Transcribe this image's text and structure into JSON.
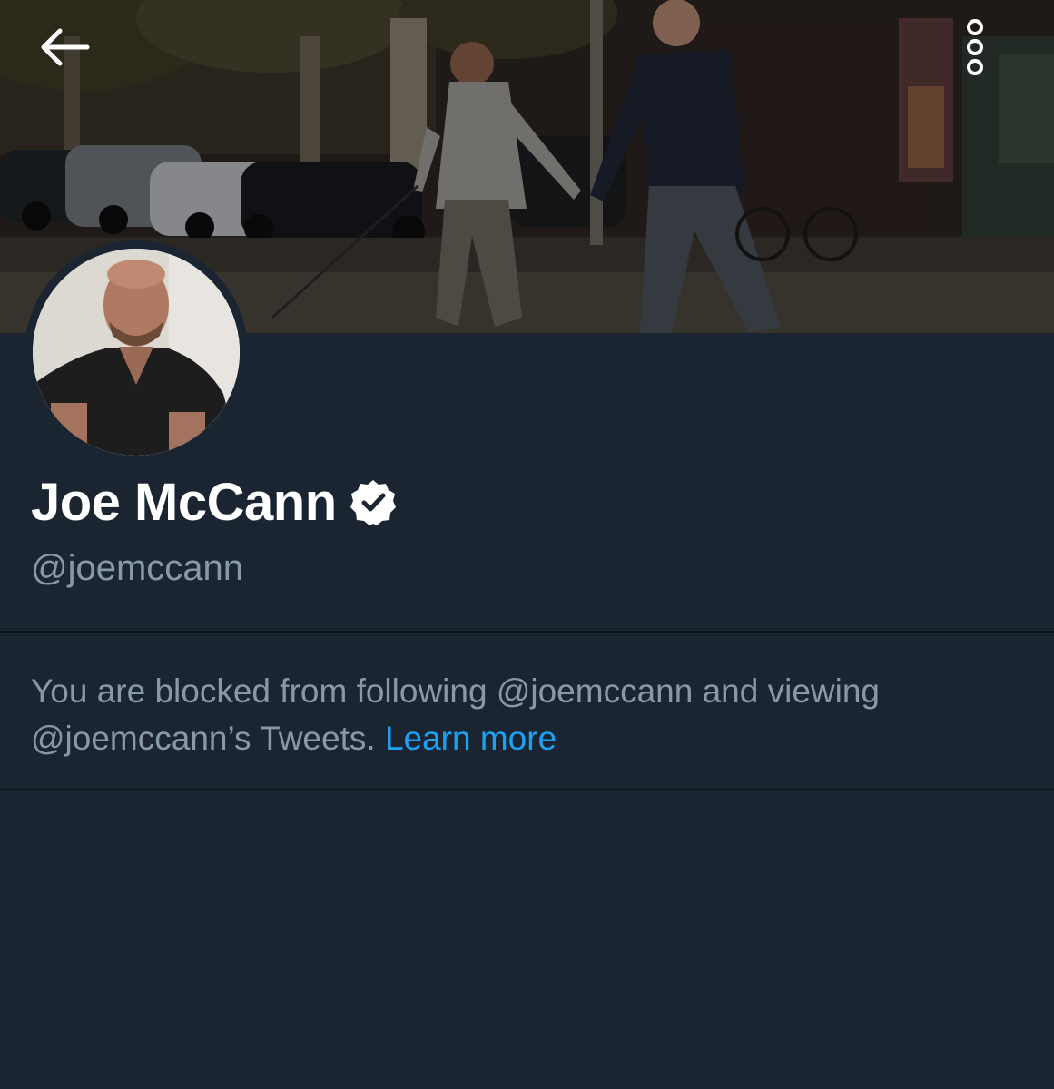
{
  "header": {
    "back_icon": "arrow-left-icon",
    "more_icon": "more-vertical-icon"
  },
  "profile": {
    "name": "Joe McCann",
    "verified_icon": "verified-badge-icon",
    "handle": "@joemccann"
  },
  "blocked_notice": {
    "text": "You are blocked from following @joemccann and viewing @joemccann’s Tweets.",
    "link_label": "Learn more"
  },
  "colors": {
    "background": "#1b2532",
    "text_primary": "#ffffff",
    "text_secondary": "#8899a6",
    "link": "#1da1f2",
    "divider": "#0d131a"
  }
}
